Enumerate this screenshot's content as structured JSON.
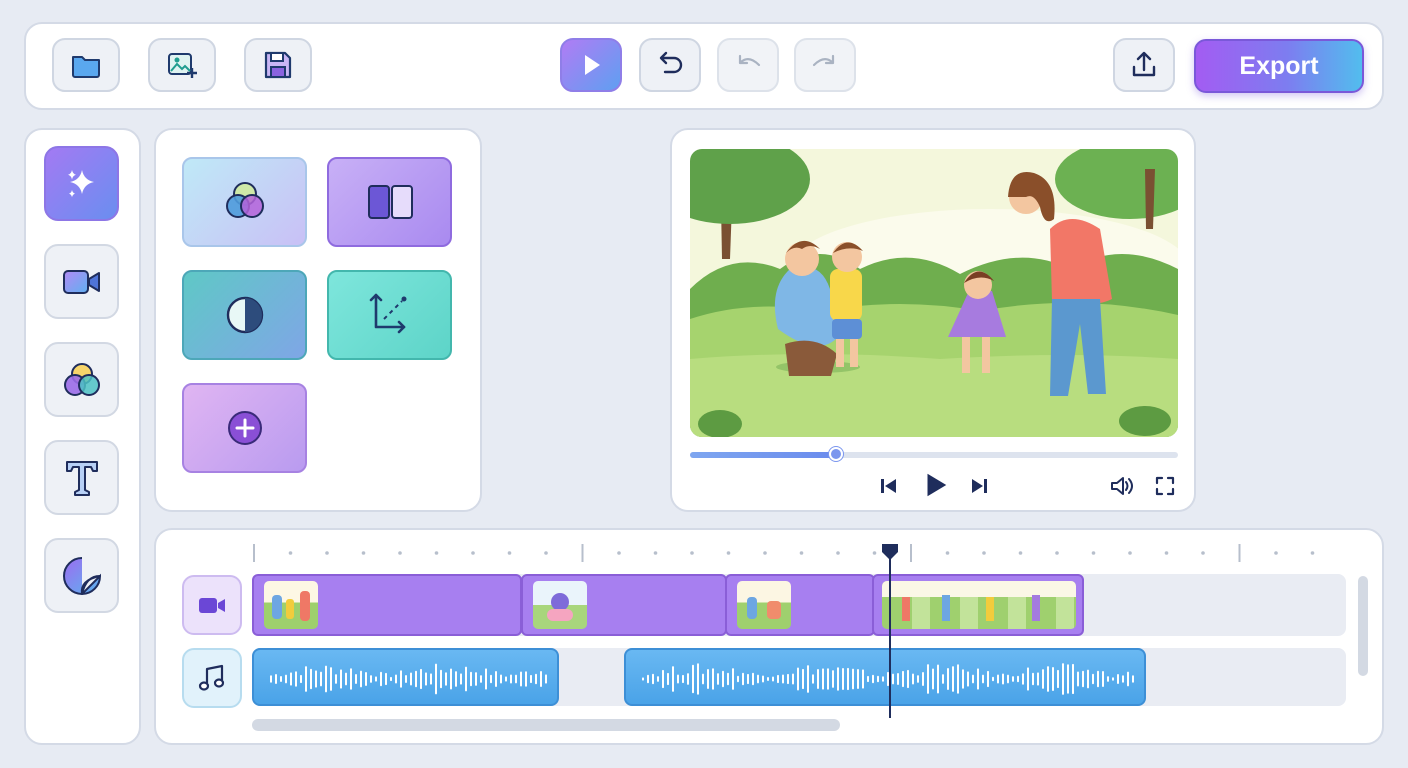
{
  "toolbar": {
    "buttons": [
      {
        "icon": "folder-icon"
      },
      {
        "icon": "image-add-icon"
      },
      {
        "icon": "save-icon"
      },
      {
        "icon": "play-icon"
      },
      {
        "icon": "undo-icon"
      },
      {
        "icon": "undo-icon",
        "disabled": true
      },
      {
        "icon": "redo-icon",
        "disabled": true
      },
      {
        "icon": "share-upload-icon"
      }
    ],
    "export_label": "Export"
  },
  "sidebar": {
    "items": [
      {
        "icon": "sparkles-icon",
        "active": true
      },
      {
        "icon": "video-camera-icon"
      },
      {
        "icon": "color-circles-icon"
      },
      {
        "icon": "text-icon"
      },
      {
        "icon": "sticker-icon"
      }
    ]
  },
  "effects_panel": {
    "tiles": [
      {
        "icon": "color-blend-icon"
      },
      {
        "icon": "split-layout-icon"
      },
      {
        "icon": "contrast-icon"
      },
      {
        "icon": "motion-path-icon"
      },
      {
        "icon": "add-icon"
      }
    ]
  },
  "preview": {
    "scene": "family-playing-in-park-illustration",
    "progress": 0.3,
    "controls": [
      "skip-back-icon",
      "play-icon",
      "skip-forward-icon",
      "volume-icon",
      "fullscreen-icon"
    ]
  },
  "timeline": {
    "playhead_fraction": 0.6,
    "video_clips": [
      {
        "thumbnail": "family-scene-thumbnail"
      },
      {
        "thumbnail": "character-scene-thumbnail"
      },
      {
        "thumbnail": "picnic-scene-thumbnail"
      },
      {
        "thumbnail": "family-filmstrip-thumbnail"
      }
    ],
    "audio_clips": 2,
    "scroll_fraction": 0.5
  },
  "colors": {
    "accent_purple": "#8b5cf6",
    "accent_blue": "#56b4f0",
    "track_video": "#a77ff0",
    "track_audio": "#4aa3e8",
    "playhead": "#1f2d5c"
  }
}
